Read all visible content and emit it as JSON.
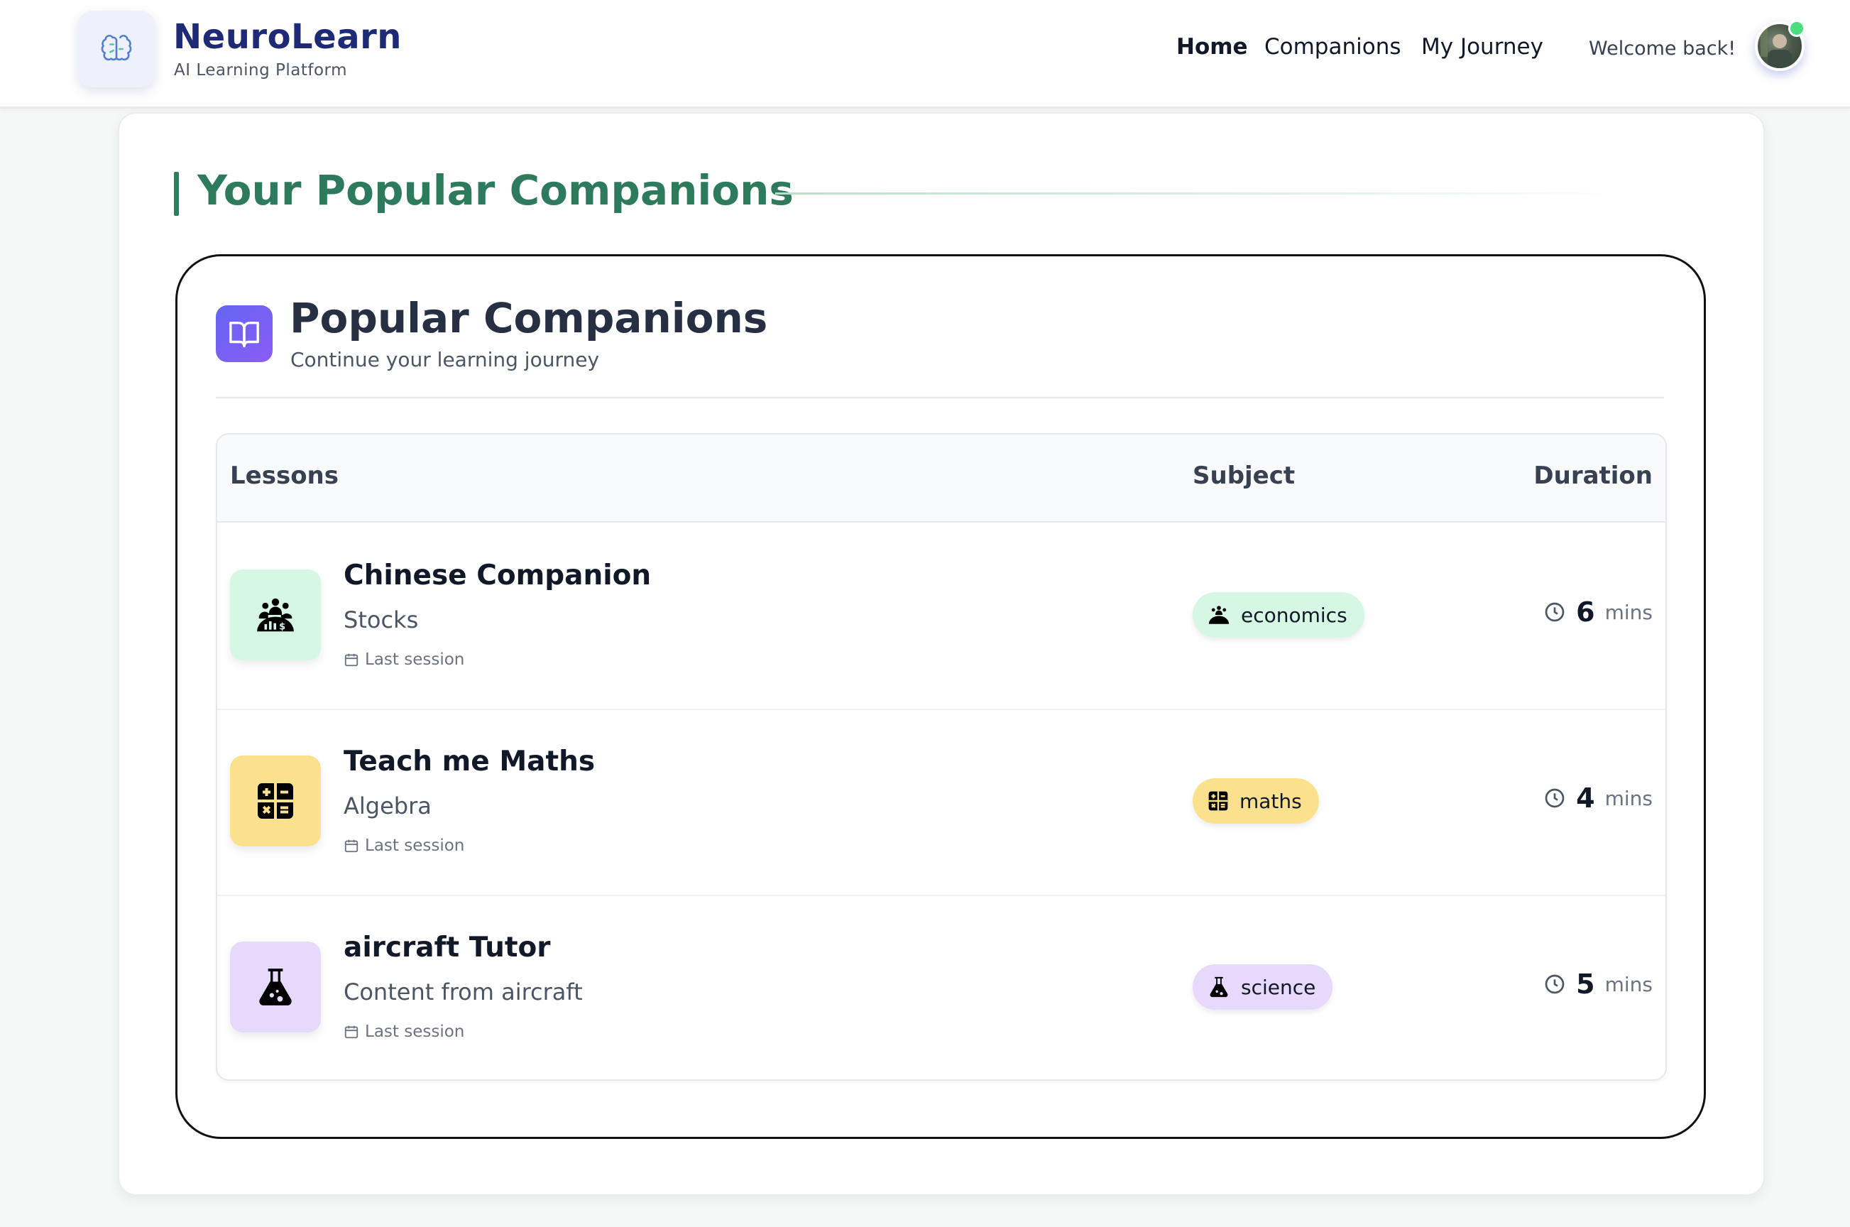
{
  "brand": {
    "name": "NeuroLearn",
    "tagline": "AI Learning Platform",
    "logo_icon": "brain-icon"
  },
  "nav": {
    "items": [
      "Home",
      "Companions",
      "My Journey"
    ],
    "active": "Home"
  },
  "user": {
    "welcome": "Welcome back!",
    "status": "online"
  },
  "section": {
    "title": "Your Popular Companions"
  },
  "card": {
    "title": "Popular Companions",
    "subtitle": "Continue your learning journey",
    "icon": "book-open-icon"
  },
  "table": {
    "headers": {
      "lessons": "Lessons",
      "subject": "Subject",
      "duration": "Duration"
    },
    "rows": [
      {
        "name": "Chinese Companion",
        "topic": "Stocks",
        "session": "Last session",
        "subject": "economics",
        "duration": "6",
        "unit": "mins",
        "icon": "economics-icon",
        "color": "#d6f7e3"
      },
      {
        "name": "Teach me Maths",
        "topic": "Algebra",
        "session": "Last session",
        "subject": "maths",
        "duration": "4",
        "unit": "mins",
        "icon": "calculator-icon",
        "color": "#fbe08d"
      },
      {
        "name": "aircraft Tutor",
        "topic": "Content from aircraft",
        "session": "Last session",
        "subject": "science",
        "duration": "5",
        "unit": "mins",
        "icon": "flask-icon",
        "color": "#e6d9fb"
      }
    ]
  },
  "colors": {
    "brand": "#1f2a77",
    "accent": "#2e7a5c",
    "card_icon": "#6366f1"
  }
}
